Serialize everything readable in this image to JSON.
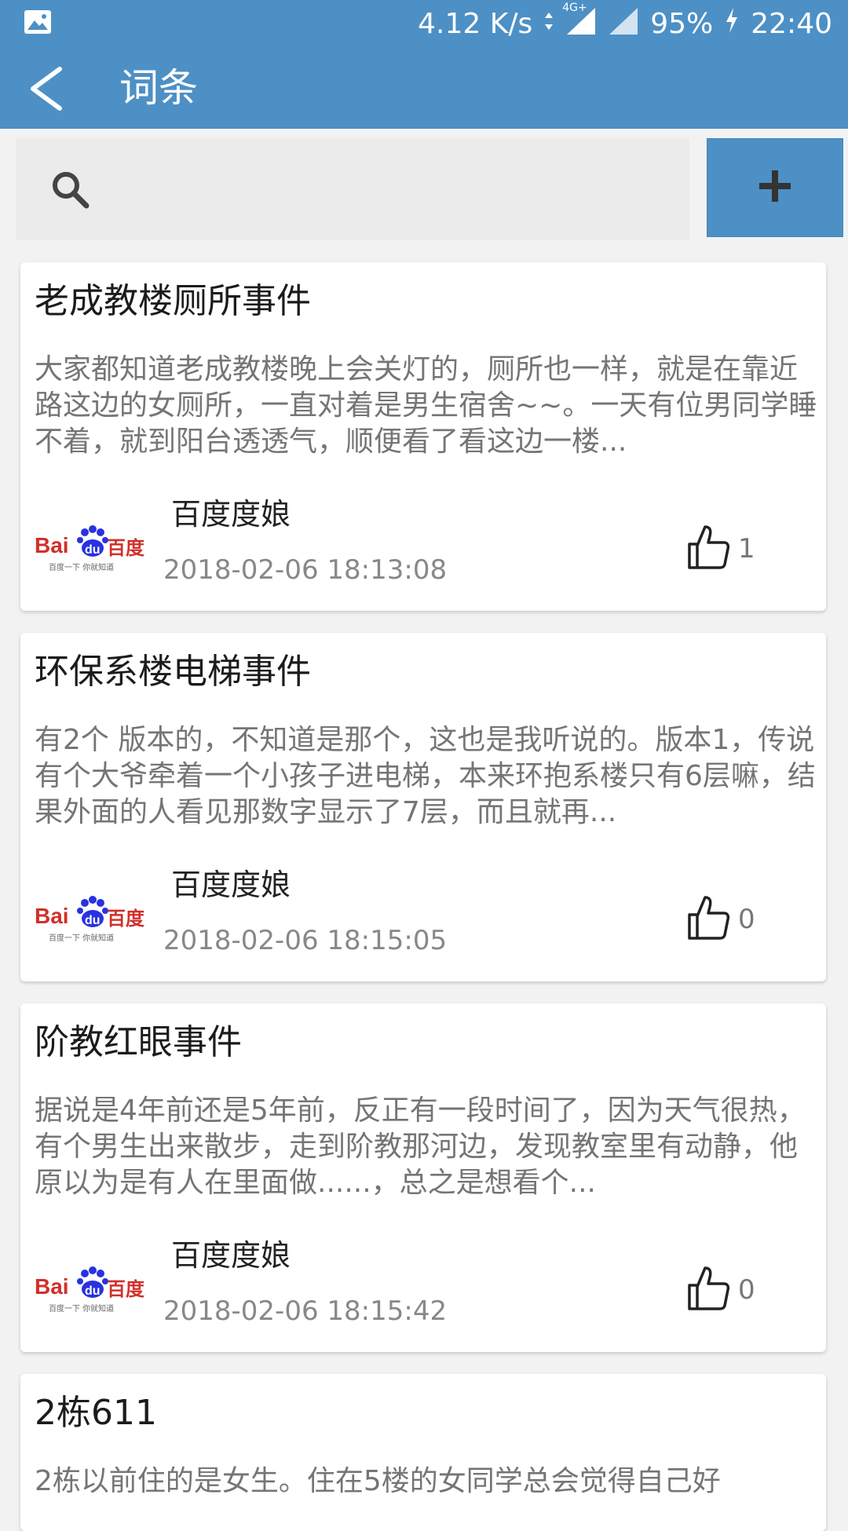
{
  "status_bar": {
    "speed": "4.12 K/s",
    "network": "4G+",
    "battery": "95%",
    "time": "22:40",
    "icons": [
      "image-icon",
      "data-arrows-icon",
      "signal-icon",
      "signal-icon",
      "charging-icon"
    ]
  },
  "app_bar": {
    "title": "词条",
    "back_icon": "back-chevron-icon"
  },
  "search": {
    "placeholder": "",
    "icon": "search-icon",
    "add_icon": "plus-icon"
  },
  "colors": {
    "primary": "#4d90c5",
    "background": "#f2f2f2",
    "card": "#ffffff"
  },
  "entries": [
    {
      "title": "老成教楼厕所事件",
      "body": "大家都知道老成教楼晚上会关灯的，厕所也一样，就是在靠近路这边的女厕所，一直对着是男生宿舍~~。一天有位男同学睡不着，就到阳台透透气，顺便看了看这边一楼...",
      "author": "百度度娘",
      "date": "2018-02-06 18:13:08",
      "likes": "1",
      "logo": {
        "brand_bai": "Bai",
        "brand_du": "du",
        "brand_cn": "百度",
        "tagline": "百度一下 你就知道"
      }
    },
    {
      "title": "环保系楼电梯事件",
      "body": "有2个 版本的，不知道是那个，这也是我听说的。版本1，传说有个大爷牵着一个小孩子进电梯，本来环抱系楼只有6层嘛，结果外面的人看见那数字显示了7层，而且就再...",
      "author": "百度度娘",
      "date": "2018-02-06 18:15:05",
      "likes": "0",
      "logo": {
        "brand_bai": "Bai",
        "brand_du": "du",
        "brand_cn": "百度",
        "tagline": "百度一下 你就知道"
      }
    },
    {
      "title": "阶教红眼事件",
      "body": "据说是4年前还是5年前，反正有一段时间了，因为天气很热，有个男生出来散步，走到阶教那河边，发现教室里有动静，他原以为是有人在里面做......，总之是想看个...",
      "author": "百度度娘",
      "date": "2018-02-06 18:15:42",
      "likes": "0",
      "logo": {
        "brand_bai": "Bai",
        "brand_du": "du",
        "brand_cn": "百度",
        "tagline": "百度一下 你就知道"
      }
    },
    {
      "title": "2栋611",
      "body": "2栋以前住的是女生。住在5楼的女同学总会觉得自己好"
    }
  ]
}
